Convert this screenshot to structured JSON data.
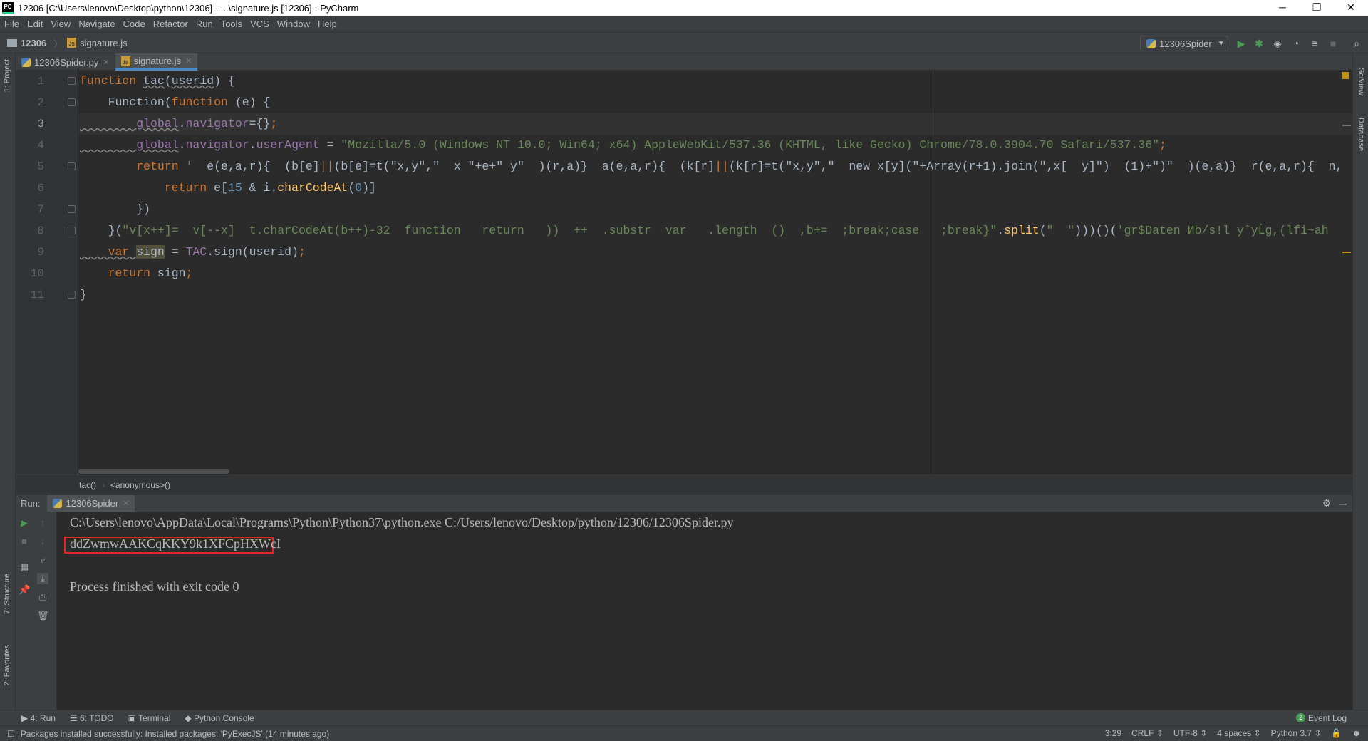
{
  "window": {
    "title": "12306 [C:\\Users\\lenovo\\Desktop\\python\\12306] - ...\\signature.js [12306] - PyCharm",
    "minimize": "─",
    "restore": "❐",
    "close": "✕"
  },
  "menu": [
    "File",
    "Edit",
    "View",
    "Navigate",
    "Code",
    "Refactor",
    "Run",
    "Tools",
    "VCS",
    "Window",
    "Help"
  ],
  "nav": {
    "project": "12306",
    "file": "signature.js",
    "run_config": "12306Spider"
  },
  "left_strip": {
    "project": "1: Project",
    "structure": "7: Structure",
    "favorites": "2: Favorites"
  },
  "right_strip": {
    "sciview": "SciView",
    "database": "Database"
  },
  "tabs": [
    {
      "label": "12306Spider.py",
      "active": false
    },
    {
      "label": "signature.js",
      "active": true
    }
  ],
  "editor": {
    "current_line": 3,
    "lines": [
      {
        "n": "1",
        "tokens": [
          [
            "kw",
            "function "
          ],
          [
            "tx ul",
            "tac"
          ],
          [
            "tx",
            "("
          ],
          [
            "tx ul",
            "userid"
          ],
          [
            "tx",
            ") {"
          ]
        ]
      },
      {
        "n": "2",
        "tokens": [
          [
            "tx",
            "    Function("
          ],
          [
            "kw",
            "function "
          ],
          [
            "tx",
            "(e) {"
          ]
        ]
      },
      {
        "n": "3",
        "tokens": [
          [
            "pr ul",
            "        global"
          ],
          [
            "tx",
            "."
          ],
          [
            "pr",
            "navigator"
          ],
          [
            "tx",
            "={}"
          ],
          [
            "kw",
            ";"
          ]
        ]
      },
      {
        "n": "4",
        "tokens": [
          [
            "pr ul",
            "        global"
          ],
          [
            "tx",
            "."
          ],
          [
            "pr",
            "navigator"
          ],
          [
            "tx",
            "."
          ],
          [
            "pr",
            "userAgent"
          ],
          [
            "tx",
            " = "
          ],
          [
            "str",
            "\"Mozilla/5.0 (Windows NT 10.0; Win64; x64) AppleWebKit/537.36 (KHTML, like Gecko) Chrome/78.0.3904.70 Safari/537.36\""
          ],
          [
            "kw",
            ";"
          ]
        ]
      },
      {
        "n": "5",
        "tokens": [
          [
            "kw",
            "        return "
          ],
          [
            "str",
            "'  "
          ],
          [
            "tx",
            "e(e,a,r){  (b[e]"
          ],
          [
            "kw",
            "||"
          ],
          [
            "tx",
            "(b[e]=t(\"x,y\",\"  x \"+e+\" y\"  )(r,a)}  a(e,a,r){  (k[r]"
          ],
          [
            "kw",
            "||"
          ],
          [
            "tx",
            "(k[r]=t(\"x,y\",\"  new x[y](\"+Array(r+1).join(\",x[  y]\")  (1)+\")\"  )(e,a)}  r(e,a,r){  n,"
          ]
        ]
      },
      {
        "n": "6",
        "tokens": [
          [
            "kw",
            "            return "
          ],
          [
            "tx",
            "e["
          ],
          [
            "num",
            "15"
          ],
          [
            "tx",
            " & i."
          ],
          [
            "fn",
            "charCodeAt"
          ],
          [
            "tx",
            "("
          ],
          [
            "num",
            "0"
          ],
          [
            "tx",
            ")]"
          ]
        ]
      },
      {
        "n": "7",
        "tokens": [
          [
            "tx",
            "        })"
          ]
        ]
      },
      {
        "n": "8",
        "tokens": [
          [
            "tx",
            "    }("
          ],
          [
            "str",
            "\"v[x++]=  v[--x]  t.charCodeAt(b++)-32  function   return   ))  ++  .substr  var   .length  ()  ,b+=  ;break;case   ;break}\""
          ],
          [
            "tx",
            "."
          ],
          [
            "fn",
            "split"
          ],
          [
            "tx",
            "("
          ],
          [
            "str",
            "\"  \""
          ],
          [
            "tx",
            ")))()("
          ],
          [
            "str",
            "'gr$Daten Иb/s!l yˆyĹg,(lfi~ah"
          ]
        ]
      },
      {
        "n": "9",
        "tokens": [
          [
            "kw ul",
            "    var "
          ],
          [
            "tx hl",
            "sign"
          ],
          [
            "tx",
            " = "
          ],
          [
            "pr",
            "TAC"
          ],
          [
            "tx",
            ".sign(userid)"
          ],
          [
            "kw",
            ";"
          ]
        ]
      },
      {
        "n": "10",
        "tokens": [
          [
            "kw",
            "    return "
          ],
          [
            "tx",
            "sign"
          ],
          [
            "kw",
            ";"
          ]
        ]
      },
      {
        "n": "11",
        "tokens": [
          [
            "tx",
            "}"
          ]
        ]
      }
    ]
  },
  "breadcrumb": [
    "tac()",
    "<anonymous>()"
  ],
  "run": {
    "label": "Run:",
    "tab": "12306Spider",
    "output": [
      "C:\\Users\\lenovo\\AppData\\Local\\Programs\\Python\\Python37\\python.exe C:/Users/lenovo/Desktop/python/12306/12306Spider.py",
      "ddZwmwAAKCqKKY9k1XFCpHXWcI",
      "Process finished with exit code 0"
    ]
  },
  "bottom_tabs": [
    "4: Run",
    "6: TODO",
    "Terminal",
    "Python Console"
  ],
  "event_log": {
    "count": "2",
    "label": "Event Log"
  },
  "status": {
    "message": "Packages installed successfully: Installed packages: 'PyExecJS' (14 minutes ago)",
    "position": "3:29",
    "line_sep": "CRLF ⇕",
    "encoding": "UTF-8 ⇕",
    "indent": "4 spaces ⇕",
    "interpreter": "Python 3.7 ⇕"
  },
  "colors": {
    "keyword": "#cc7832",
    "string": "#6a8759",
    "property": "#9876aa",
    "function": "#ffc66d",
    "number": "#6897bb",
    "highlight_box": "#e0281f",
    "run_green": "#499c54"
  }
}
